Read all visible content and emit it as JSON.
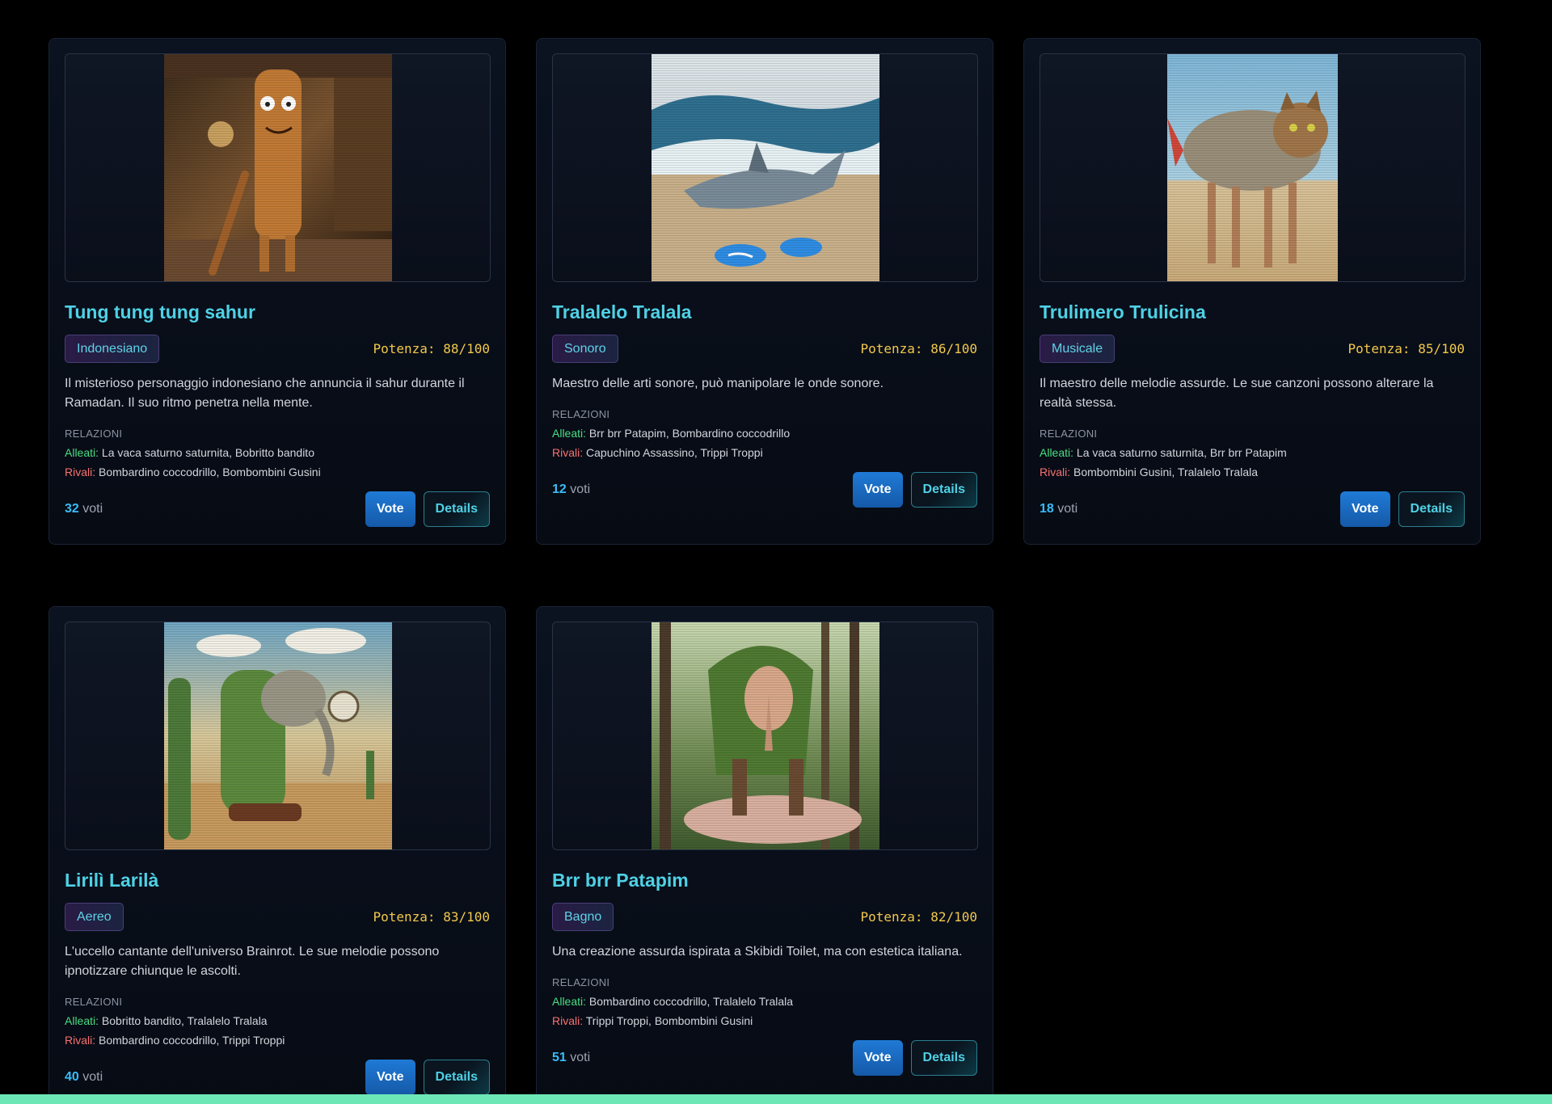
{
  "cards": [
    {
      "name": "Tung tung tung sahur",
      "tag": "Indonesiano",
      "potenza": "Potenza: 88/100",
      "description": "Il misterioso personaggio indonesiano che annuncia il sahur durante il Ramadan. Il suo ritmo penetra nella mente.",
      "relations_title": "RELAZIONI",
      "allies_label": "Alleati:",
      "allies": "La vaca saturno saturnita, Bobritto bandito",
      "rivals_label": "Rivali:",
      "rivals": "Bombardino coccodrillo, Bombombini Gusini",
      "votes": "32",
      "votes_label": "voti",
      "vote_button": "Vote",
      "details_button": "Details"
    },
    {
      "name": "Tralalelo Tralala",
      "tag": "Sonoro",
      "potenza": "Potenza: 86/100",
      "description": "Maestro delle arti sonore, può manipolare le onde sonore.",
      "relations_title": "RELAZIONI",
      "allies_label": "Alleati:",
      "allies": "Brr brr Patapim, Bombardino coccodrillo",
      "rivals_label": "Rivali:",
      "rivals": "Capuchino Assassino, Trippi Troppi",
      "votes": "12",
      "votes_label": "voti",
      "vote_button": "Vote",
      "details_button": "Details"
    },
    {
      "name": "Trulimero Trulicina",
      "tag": "Musicale",
      "potenza": "Potenza: 85/100",
      "description": "Il maestro delle melodie assurde. Le sue canzoni possono alterare la realtà stessa.",
      "relations_title": "RELAZIONI",
      "allies_label": "Alleati:",
      "allies": "La vaca saturno saturnita, Brr brr Patapim",
      "rivals_label": "Rivali:",
      "rivals": "Bombombini Gusini, Tralalelo Tralala",
      "votes": "18",
      "votes_label": "voti",
      "vote_button": "Vote",
      "details_button": "Details"
    },
    {
      "name": "Lirilì Larilà",
      "tag": "Aereo",
      "potenza": "Potenza: 83/100",
      "description": "L'uccello cantante dell'universo Brainrot. Le sue melodie possono ipnotizzare chiunque le ascolti.",
      "relations_title": "RELAZIONI",
      "allies_label": "Alleati:",
      "allies": "Bobritto bandito, Tralalelo Tralala",
      "rivals_label": "Rivali:",
      "rivals": "Bombardino coccodrillo, Trippi Troppi",
      "votes": "40",
      "votes_label": "voti",
      "vote_button": "Vote",
      "details_button": "Details"
    },
    {
      "name": "Brr brr Patapim",
      "tag": "Bagno",
      "potenza": "Potenza: 82/100",
      "description": "Una creazione assurda ispirata a Skibidi Toilet, ma con estetica italiana.",
      "relations_title": "RELAZIONI",
      "allies_label": "Alleati:",
      "allies": "Bombardino coccodrillo, Tralalelo Tralala",
      "rivals_label": "Rivali:",
      "rivals": "Trippi Troppi, Bombombini Gusini",
      "votes": "51",
      "votes_label": "voti",
      "vote_button": "Vote",
      "details_button": "Details"
    }
  ]
}
